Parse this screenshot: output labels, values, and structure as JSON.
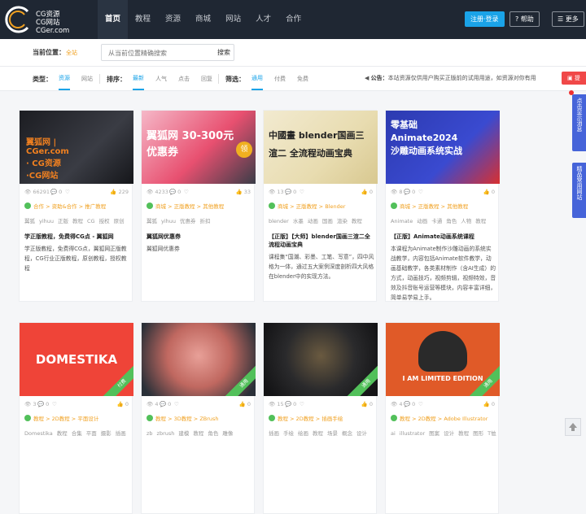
{
  "header": {
    "logo": {
      "line1": "CG资源",
      "line2": "CG网站",
      "line3": "CGer.com"
    },
    "nav": [
      "首页",
      "教程",
      "资源",
      "商城",
      "网站",
      "人才",
      "合作"
    ],
    "register_label": "注册·登录",
    "help_label": "帮助",
    "more_label": "更多"
  },
  "crumb": {
    "label": "当前位置：",
    "current": "全站",
    "search_placeholder": "从当前位置精确搜索",
    "search_button": "搜索"
  },
  "filters": {
    "type_label": "类型：",
    "type_options": [
      "资源",
      "网站"
    ],
    "sort_label": "排序：",
    "sort_options": [
      "最新",
      "人气",
      "点击",
      "回复"
    ],
    "filter_label": "筛选：",
    "filter_options": [
      "通用",
      "付费",
      "免费"
    ],
    "notice_label": "公告：",
    "notice_text": "本站资源仅供用户购买正版前的试用用途，如资源对你有用",
    "red_button": "提"
  },
  "side": {
    "tab1": "点击显示消息",
    "tab2": "精品常用网站"
  },
  "colors": {
    "accent": "#1aa3e8",
    "category": "#f0a020",
    "ribbon": "#52c05a",
    "header_bg": "#1f2733"
  },
  "cards": [
    {
      "thumb_text": "翼狐网 | CGer.com · CG资源·CG网站",
      "stats": {
        "views": "66291",
        "comments": "0",
        "likes": "229"
      },
      "cats": [
        "合作",
        "资助&合作",
        "推广教程"
      ],
      "tags": [
        "翼狐",
        "yihuu",
        "正版",
        "教程",
        "CG",
        "授权",
        "原创"
      ],
      "title": "学正版教程，免费得CG点 - 翼狐网",
      "desc": "学正版教程，免费得CG点，翼狐网正版教程，CG行业正版教程，原创教程，授权教程"
    },
    {
      "thumb_text": "翼狐网 30-300元优惠券",
      "thumb_badge": "领",
      "stats": {
        "views": "4233",
        "comments": "0",
        "likes": "33"
      },
      "cats": [
        "商城",
        "正版教程",
        "其他教程"
      ],
      "tags": [
        "翼狐",
        "yihuu",
        "优惠券",
        "折扣"
      ],
      "title": "翼狐网优惠券",
      "desc": "翼狐网优惠券"
    },
    {
      "thumb_text": "中國畫 blender国画三渲二 全流程动画宝典",
      "stats": {
        "views": "13",
        "comments": "0",
        "likes": "0"
      },
      "cats": [
        "商城",
        "正版教程",
        "Blender"
      ],
      "tags": [
        "blender",
        "水墨",
        "动画",
        "国画",
        "渲染",
        "教程"
      ],
      "title": "【正版】【大师】blender国画三渲二全流程动画宝典",
      "desc": "课程集“国潮、彩墨、工笔、写意”，四中风格为一体，通过五大案例深度剖析四大风格在blender中的实现方法。"
    },
    {
      "thumb_text": "零基础 Animate2024 沙雕动画系统实战",
      "stats": {
        "views": "8",
        "comments": "0",
        "likes": "0"
      },
      "cats": [
        "商城",
        "正版教程",
        "其他教程"
      ],
      "tags": [
        "Animate",
        "动画",
        "卡通",
        "角色",
        "人物",
        "教程"
      ],
      "title": "【正版】Animate动画系统课程",
      "desc": "本课程为Animate制作沙雕动画的系统实战教学，内容包括Animate软件教学，动画基础教学，各类素材制作（含AI生成）的方式，动画技巧，视频剪辑，视频特效，音效及抖音账号运营等模块，内容丰富详细，简单易学易上手。"
    },
    {
      "thumb_text": "DOMESTIKA",
      "ribbon": "付费",
      "stats": {
        "views": "3",
        "comments": "0",
        "likes": "0"
      },
      "cats": [
        "教程",
        "2D教程",
        "平面设计"
      ],
      "tags": [
        "Domestika",
        "教程",
        "合集",
        "平面",
        "摄影",
        "插画"
      ]
    },
    {
      "thumb_text": "",
      "ribbon": "通用",
      "stats": {
        "views": "4",
        "comments": "0",
        "likes": "0"
      },
      "cats": [
        "教程",
        "3D教程",
        "ZBrush"
      ],
      "tags": [
        "zb",
        "zbrush",
        "建模",
        "教程",
        "角色",
        "雕像"
      ]
    },
    {
      "thumb_text": "",
      "ribbon": "通用",
      "stats": {
        "views": "15",
        "comments": "0",
        "likes": "0"
      },
      "cats": [
        "教程",
        "2D教程",
        "插画手绘"
      ],
      "tags": [
        "插画",
        "手绘",
        "绘画",
        "教程",
        "场景",
        "概念",
        "设计"
      ]
    },
    {
      "thumb_text": "I AM LIMITED EDITION",
      "ribbon": "通用",
      "stats": {
        "views": "4",
        "comments": "0",
        "likes": "0"
      },
      "cats": [
        "教程",
        "2D教程",
        "Adobe Illustrator"
      ],
      "tags": [
        "ai",
        "illustrator",
        "图案",
        "设计",
        "教程",
        "图形",
        "T恤"
      ]
    }
  ]
}
